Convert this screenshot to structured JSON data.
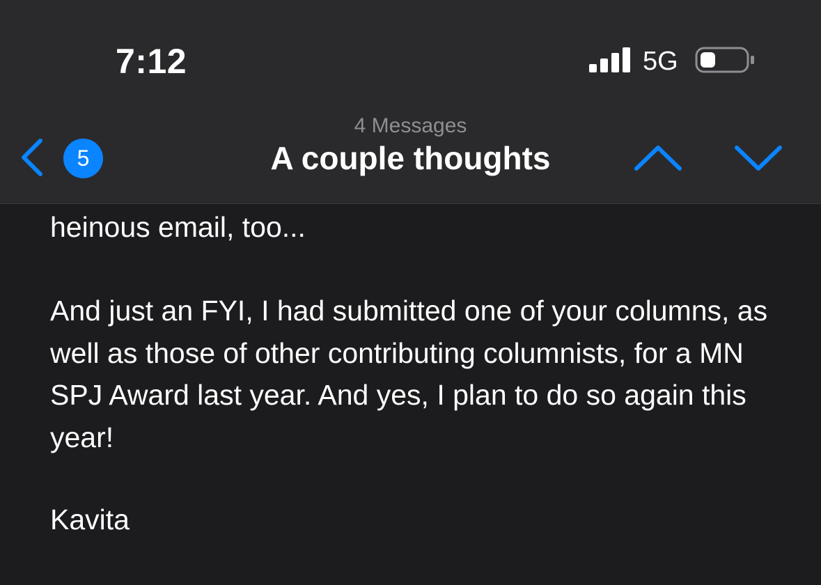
{
  "status_bar": {
    "time": "7:12",
    "network": "5G"
  },
  "header": {
    "message_count": "4 Messages",
    "title": "A couple thoughts",
    "unread_badge": "5"
  },
  "email": {
    "para1": "heinous email, too...",
    "para2": "And just an FYI, I had submitted one of your columns, as well as those of other contributing columnists, for a MN SPJ Award last year. And yes, I plan to do so again this year!",
    "signature": "Kavita"
  },
  "colors": {
    "accent": "#0a84ff",
    "header_bg": "#2a2a2c",
    "body_bg": "#1c1c1e",
    "secondary_text": "#8e8e93"
  },
  "icons": {
    "back": "chevron-left-icon",
    "previous": "chevron-up-icon",
    "next": "chevron-down-icon",
    "signal": "cellular-signal-icon",
    "battery": "battery-icon"
  }
}
